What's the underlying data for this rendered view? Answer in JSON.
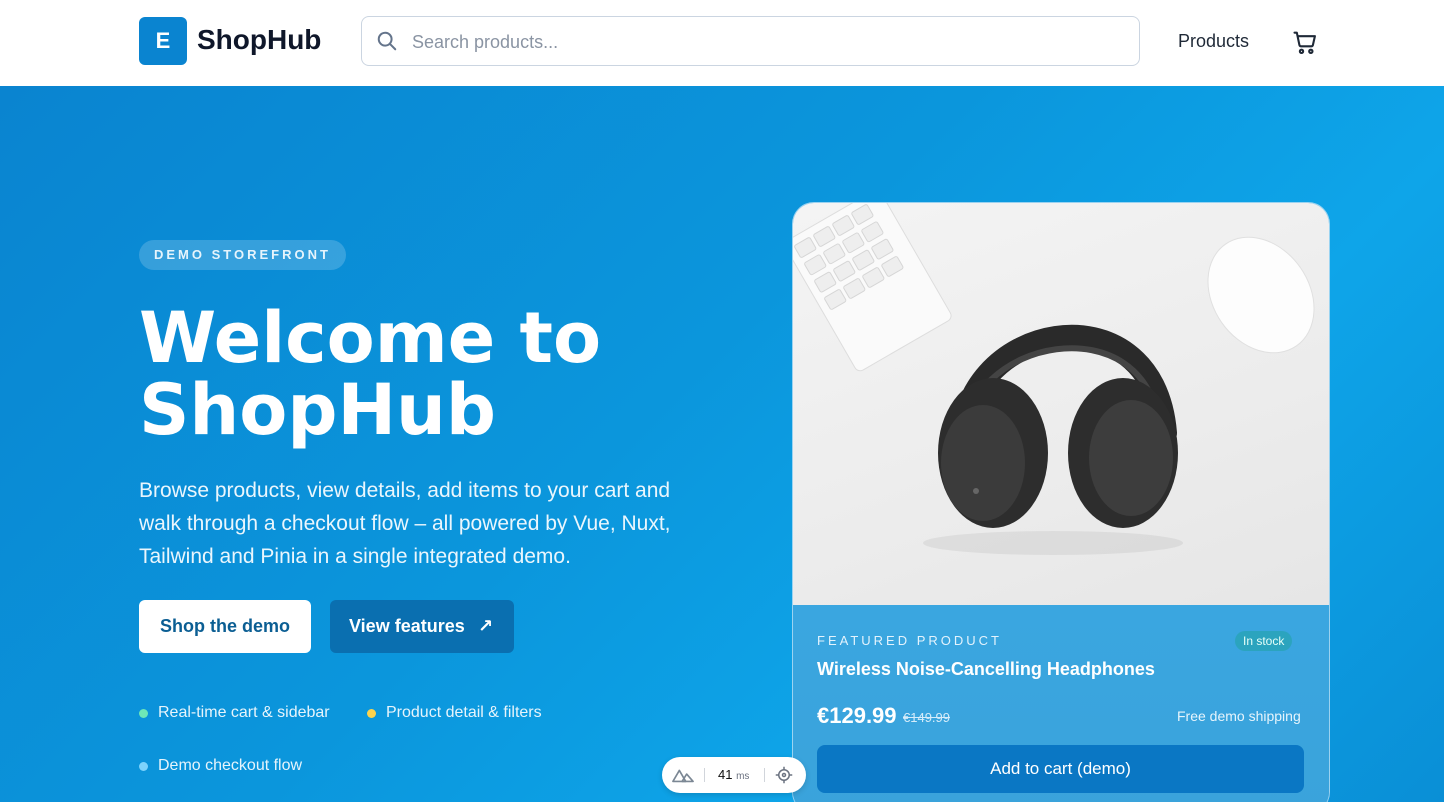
{
  "header": {
    "logo_letter": "E",
    "brand": "ShopHub",
    "search_placeholder": "Search products...",
    "nav_products": "Products",
    "cart_icon": "cart-icon"
  },
  "hero": {
    "badge": "DEMO STOREFRONT",
    "headline": "Welcome to ShopHub",
    "description": "Browse products, view details, add items to your cart and walk through a checkout flow – all powered by Vue, Nuxt, Tailwind and Pinia in a single integrated demo.",
    "primary_button": "Shop the demo",
    "secondary_button": "View features",
    "secondary_icon": "↗",
    "features": [
      {
        "label": "Real-time cart & sidebar",
        "color": "#6ee7b7"
      },
      {
        "label": "Product detail & filters",
        "color": "#fcd34d"
      },
      {
        "label": "Demo checkout flow",
        "color": "#7dd3fc"
      }
    ]
  },
  "featured": {
    "label": "FEATURED PRODUCT",
    "stock": "In stock",
    "name": "Wireless Noise-Cancelling Headphones",
    "price": "€129.99",
    "old_price": "€149.99",
    "shipping": "Free demo shipping",
    "add_to_cart": "Add to cart (demo)"
  },
  "devtools": {
    "ms_value": "41",
    "ms_unit": "ms"
  },
  "colors": {
    "brand": "#0a84d0",
    "hero_gradient_start": "#0a84d0",
    "hero_gradient_end": "#0ea5e9"
  }
}
